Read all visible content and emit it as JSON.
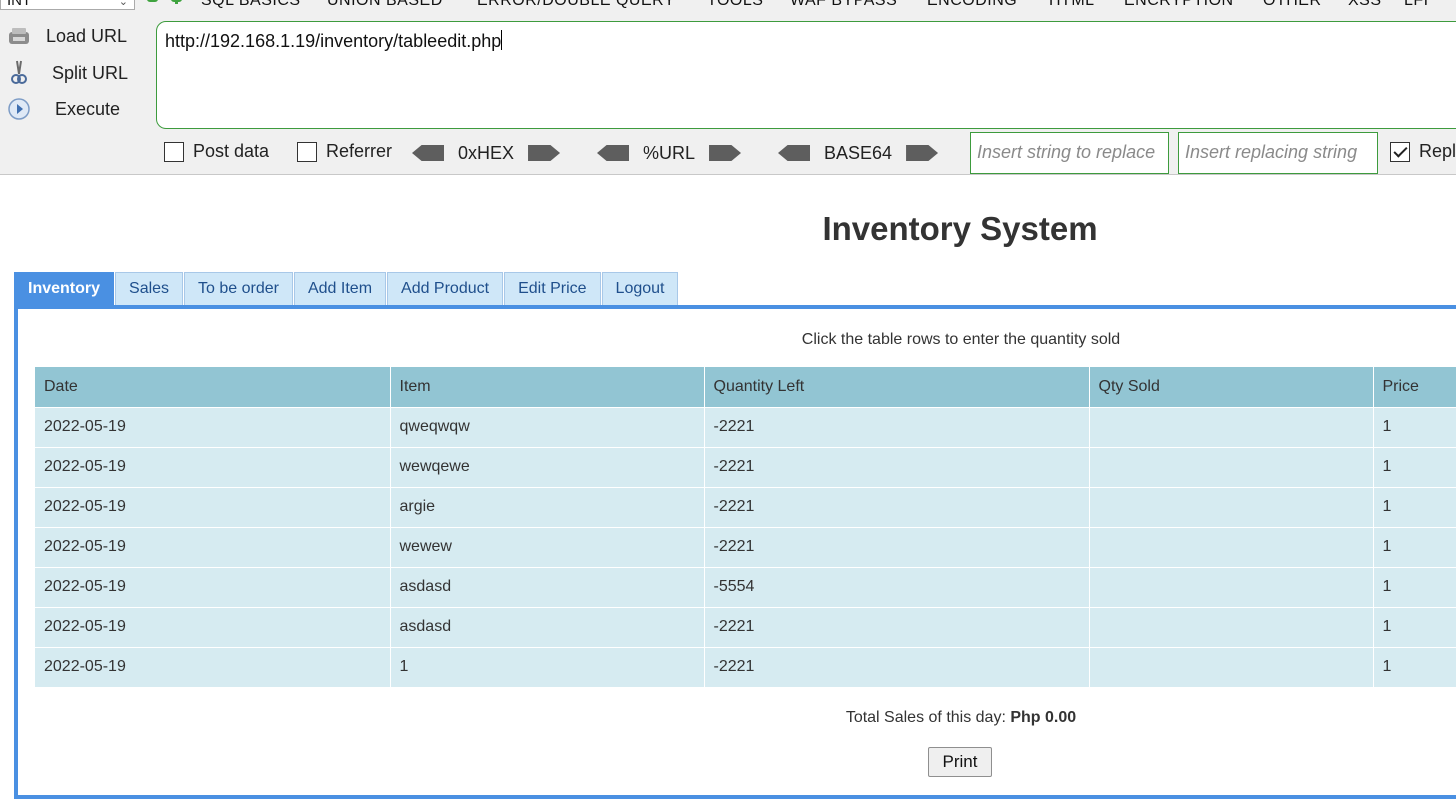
{
  "hackbar": {
    "sql_select": "INT",
    "menus": [
      "SQL BASICS",
      "UNION BASED",
      "ERROR/DOUBLE QUERY",
      "TOOLS",
      "WAF BYPASS",
      "ENCODING",
      "HTML",
      "ENCRYPTION",
      "OTHER",
      "XSS",
      "LFI"
    ],
    "load_url": "Load URL",
    "split_url": "Split URL",
    "execute": "Execute",
    "url": "http://192.168.1.19/inventory/tableedit.php",
    "post_data": "Post data",
    "referrer": "Referrer",
    "hex": "0xHEX",
    "url_enc": "%URL",
    "base64": "BASE64",
    "insert_placeholder": "Insert string to replace",
    "replacing_placeholder": "Insert replacing string",
    "replace_all": "Replace All"
  },
  "page": {
    "title": "Inventory System",
    "tabs": [
      "Inventory",
      "Sales",
      "To be order",
      "Add Item",
      "Add Product",
      "Edit Price",
      "Logout"
    ],
    "instruction": "Click the table rows to enter the quantity sold",
    "table": {
      "headers": [
        "Date",
        "Item",
        "Quantity Left",
        "Qty Sold",
        "Price"
      ],
      "rows": [
        [
          "2022-05-19",
          "qweqwqw",
          "-2221",
          "",
          "1"
        ],
        [
          "2022-05-19",
          "wewqewe",
          "-2221",
          "",
          "1"
        ],
        [
          "2022-05-19",
          "argie",
          "-2221",
          "",
          "1"
        ],
        [
          "2022-05-19",
          "wewew",
          "-2221",
          "",
          "1"
        ],
        [
          "2022-05-19",
          "asdasd",
          "-5554",
          "",
          "1"
        ],
        [
          "2022-05-19",
          "asdasd",
          "-2221",
          "",
          "1"
        ],
        [
          "2022-05-19",
          "1",
          "-2221",
          "",
          "1"
        ]
      ]
    },
    "total_label": "Total Sales of this day:",
    "total_value": "Php 0.00",
    "print": "Print"
  }
}
